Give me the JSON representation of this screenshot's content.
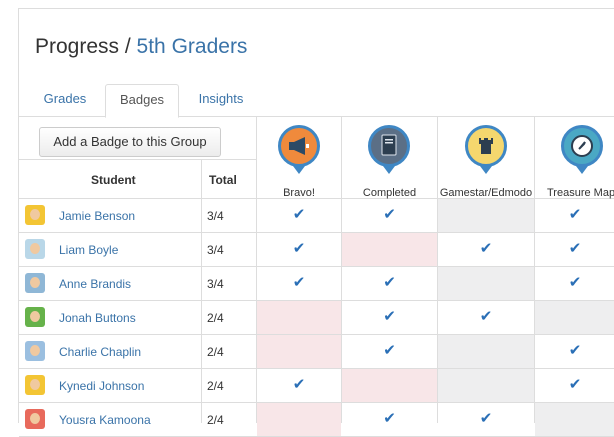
{
  "header": {
    "title_prefix": "Progress / ",
    "group_name": "5th Graders"
  },
  "tabs": [
    {
      "label": "Grades"
    },
    {
      "label": "Badges"
    },
    {
      "label": "Insights"
    }
  ],
  "actions": {
    "add_badge": "Add a Badge to this Group"
  },
  "columns": {
    "student": "Student",
    "total": "Total"
  },
  "badges": [
    {
      "name": "Bravo!",
      "icon": "megaphone-icon",
      "color": "#f08a3c"
    },
    {
      "name": "Completed",
      "icon": "book-icon",
      "color": "#5b6f86"
    },
    {
      "name": "Gamestar/Edmodo",
      "icon": "castle-icon",
      "color": "#f5d76e"
    },
    {
      "name": "Treasure Map",
      "icon": "compass-icon",
      "color": "#4aa8c4"
    }
  ],
  "students": [
    {
      "name": "Jamie Benson",
      "total": "3/4",
      "badges": [
        "check",
        "check",
        "gray",
        "check"
      ],
      "avatar_color": "#f3c534"
    },
    {
      "name": "Liam Boyle",
      "total": "3/4",
      "badges": [
        "check",
        "pink",
        "check",
        "check"
      ],
      "avatar_color": "#b9d7e8"
    },
    {
      "name": "Anne Brandis",
      "total": "3/4",
      "badges": [
        "check",
        "check",
        "gray",
        "check"
      ],
      "avatar_color": "#8fb7d6"
    },
    {
      "name": "Jonah Buttons",
      "total": "2/4",
      "badges": [
        "pink",
        "check",
        "check",
        "gray"
      ],
      "avatar_color": "#66b24a"
    },
    {
      "name": "Charlie Chaplin",
      "total": "2/4",
      "badges": [
        "pink",
        "check",
        "gray",
        "check"
      ],
      "avatar_color": "#9bbfe0"
    },
    {
      "name": "Kynedi Johnson",
      "total": "2/4",
      "badges": [
        "check",
        "pink",
        "gray",
        "check"
      ],
      "avatar_color": "#f3c534"
    },
    {
      "name": "Yousra Kamoona",
      "total": "2/4",
      "badges": [
        "pink",
        "check",
        "check",
        "gray"
      ],
      "avatar_color": "#e86a5c"
    }
  ],
  "check_glyph": "✔",
  "colors": {
    "link": "#3a73a8",
    "check": "#2a6fb6",
    "missing": "#f8e6e8",
    "not_applicable": "#eeeeef"
  }
}
